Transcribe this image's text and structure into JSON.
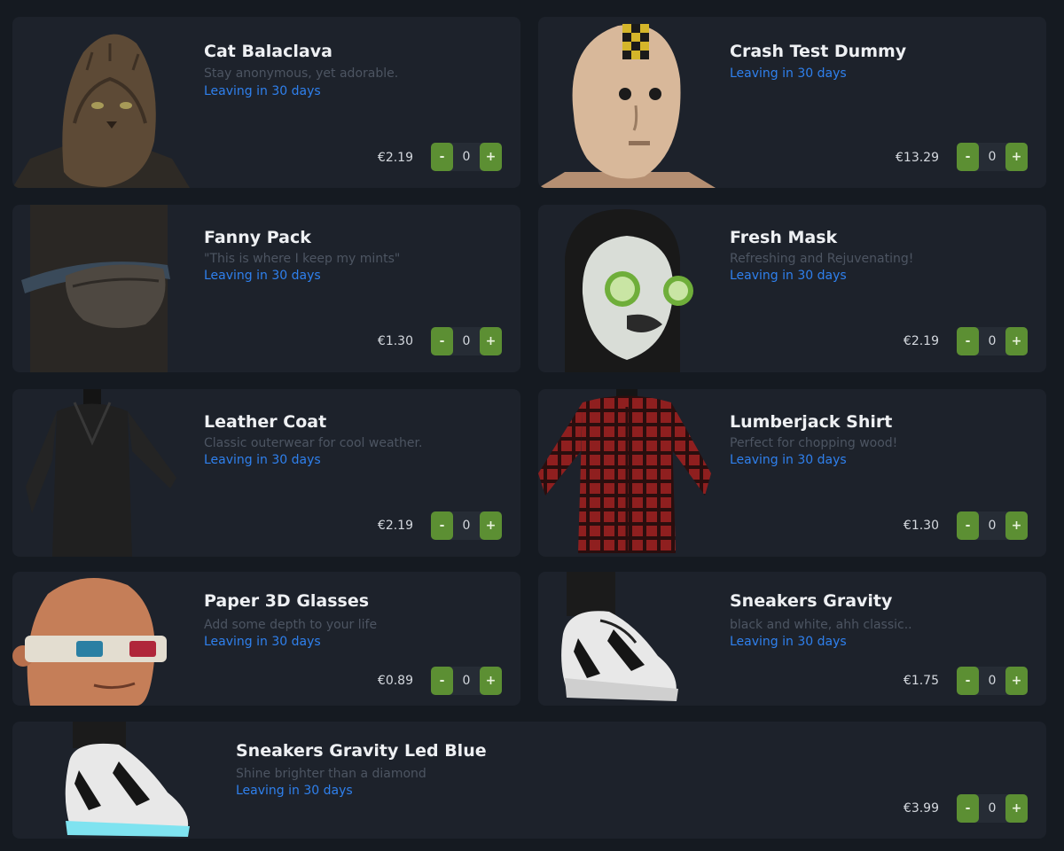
{
  "colors": {
    "background": "#151a21",
    "card": "#1d222b",
    "leaving_text": "#2f80ed",
    "stepper_button": "#5c8f33"
  },
  "items": [
    {
      "name": "Cat Balaclava",
      "description": "Stay anonymous, yet adorable.",
      "leaving": "Leaving in 30 days",
      "price": "€2.19",
      "quantity": "0",
      "minus": "-",
      "plus": "+",
      "icon": "cat-balaclava-icon"
    },
    {
      "name": "Crash Test Dummy",
      "description": "",
      "leaving": "Leaving in 30 days",
      "price": "€13.29",
      "quantity": "0",
      "minus": "-",
      "plus": "+",
      "icon": "crash-test-dummy-icon"
    },
    {
      "name": "Fanny Pack",
      "description": "\"This is where I keep my mints\"",
      "leaving": "Leaving in 30 days",
      "price": "€1.30",
      "quantity": "0",
      "minus": "-",
      "plus": "+",
      "icon": "fanny-pack-icon"
    },
    {
      "name": "Fresh Mask",
      "description": "Refreshing and Rejuvenating!",
      "leaving": "Leaving in 30 days",
      "price": "€2.19",
      "quantity": "0",
      "minus": "-",
      "plus": "+",
      "icon": "fresh-mask-icon"
    },
    {
      "name": "Leather Coat",
      "description": "Classic outerwear for cool weather.",
      "leaving": "Leaving in 30 days",
      "price": "€2.19",
      "quantity": "0",
      "minus": "-",
      "plus": "+",
      "icon": "leather-coat-icon"
    },
    {
      "name": "Lumberjack Shirt",
      "description": "Perfect for chopping wood!",
      "leaving": "Leaving in 30 days",
      "price": "€1.30",
      "quantity": "0",
      "minus": "-",
      "plus": "+",
      "icon": "lumberjack-shirt-icon"
    },
    {
      "name": "Paper 3D Glasses",
      "description": "Add some depth to your life",
      "leaving": "Leaving in 30 days",
      "price": "€0.89",
      "quantity": "0",
      "minus": "-",
      "plus": "+",
      "icon": "paper-3d-glasses-icon"
    },
    {
      "name": "Sneakers Gravity",
      "description": "black and white, ahh classic..",
      "leaving": "Leaving in 30 days",
      "price": "€1.75",
      "quantity": "0",
      "minus": "-",
      "plus": "+",
      "icon": "sneakers-gravity-icon"
    },
    {
      "name": "Sneakers Gravity Led Blue",
      "description": "Shine brighter than a diamond",
      "leaving": "Leaving in 30 days",
      "price": "€3.99",
      "quantity": "0",
      "minus": "-",
      "plus": "+",
      "icon": "sneakers-led-blue-icon"
    }
  ]
}
